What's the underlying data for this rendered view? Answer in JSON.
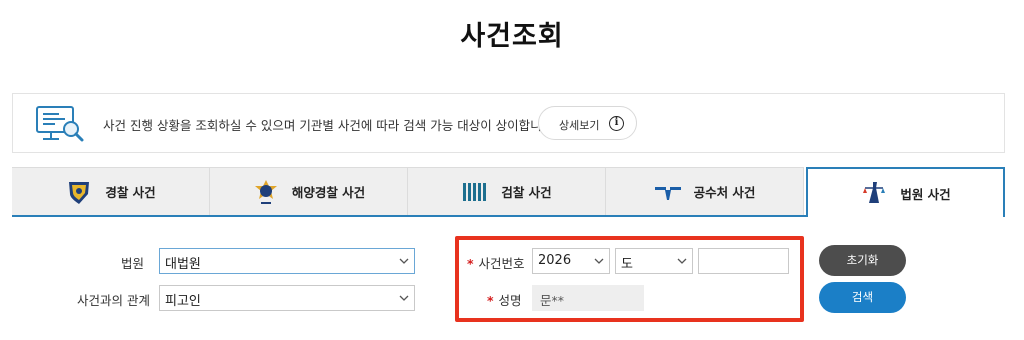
{
  "page": {
    "title": "사건조회"
  },
  "info": {
    "text": "사건 진행 상황을 조회하실 수 있으며 기관별 사건에 따라 검색 가능 대상이 상이합니다.",
    "detail_button": "상세보기",
    "detail_icon": "i"
  },
  "tabs": [
    {
      "label": "경찰 사건",
      "icon": "police-emblem-icon"
    },
    {
      "label": "해양경찰 사건",
      "icon": "coast-guard-emblem-icon"
    },
    {
      "label": "검찰 사건",
      "icon": "prosecution-emblem-icon"
    },
    {
      "label": "공수처 사건",
      "icon": "cio-emblem-icon"
    },
    {
      "label": "법원 사건",
      "icon": "court-emblem-icon",
      "active": true
    }
  ],
  "form": {
    "court_label": "법원",
    "court_value": "대법원",
    "relation_label": "사건과의 관계",
    "relation_value": "피고인",
    "case_number_label": "사건번호",
    "case_year": "2026",
    "case_type": "도",
    "case_serial": "",
    "name_label": "성명",
    "name_value": "문**",
    "required_mark": "*"
  },
  "buttons": {
    "reset": "초기화",
    "search": "검색"
  },
  "colors": {
    "accent": "#2a7fb8",
    "highlight": "#e8321e",
    "search": "#1b7fc7",
    "reset": "#4d4d4d"
  }
}
